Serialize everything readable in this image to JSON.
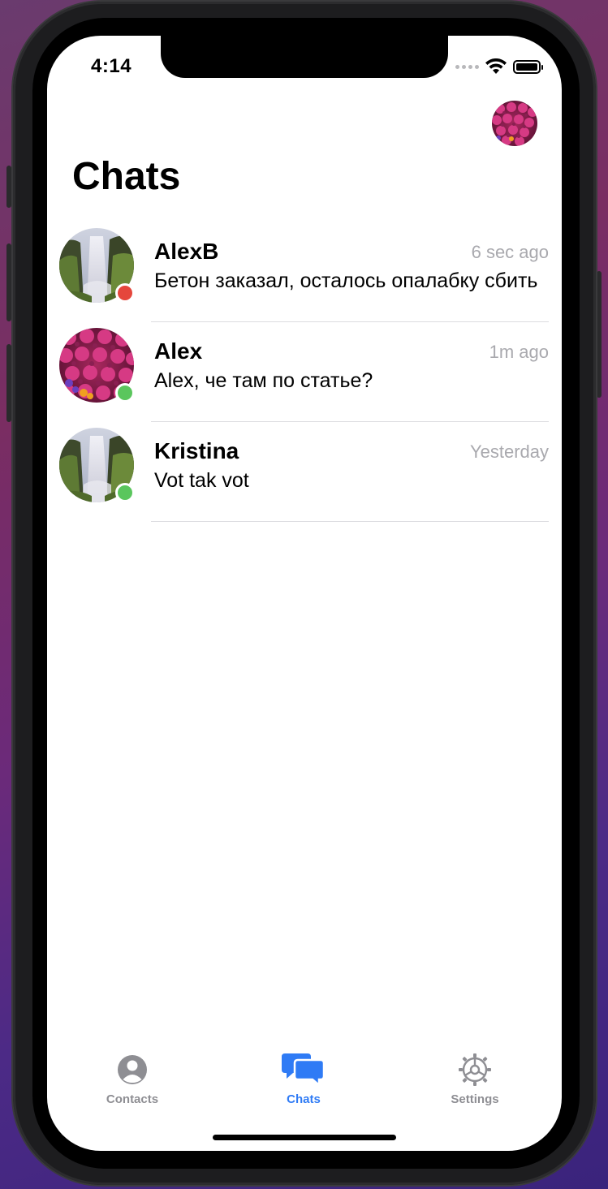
{
  "status_bar": {
    "time": "4:14"
  },
  "header": {
    "title": "Chats"
  },
  "chats": [
    {
      "name": "AlexB",
      "time": "6 sec ago",
      "preview": "Бетон заказал, осталось опалабку сбить",
      "avatar": "waterfall-photo",
      "presence": "offline",
      "presence_color": "#e5463c"
    },
    {
      "name": "Alex",
      "time": "1m ago",
      "preview": "Alex, че там по статье?",
      "avatar": "flowers-photo",
      "presence": "online",
      "presence_color": "#5ac65d"
    },
    {
      "name": "Kristina",
      "time": "Yesterday",
      "preview": "Vot tak vot",
      "avatar": "waterfall-photo",
      "presence": "online",
      "presence_color": "#5ac65d"
    }
  ],
  "tab_bar": {
    "tabs": [
      {
        "label": "Contacts",
        "icon": "person-circle-icon",
        "active": false
      },
      {
        "label": "Chats",
        "icon": "chat-bubbles-icon",
        "active": true
      },
      {
        "label": "Settings",
        "icon": "gear-icon",
        "active": false
      }
    ],
    "active_color": "#2f7bf5",
    "inactive_color": "#8e8e93"
  }
}
